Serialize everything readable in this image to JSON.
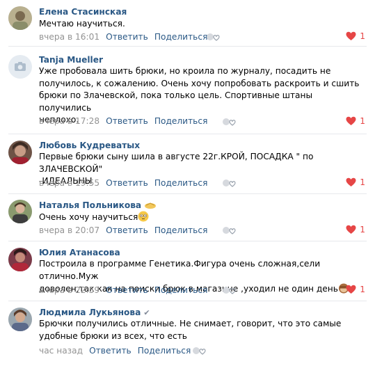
{
  "actions": {
    "reply": "Ответить",
    "share": "Поделиться"
  },
  "colors": {
    "link": "#2a5885",
    "meta": "#939393",
    "like": "#e64646"
  },
  "comments": [
    {
      "author": "Елена Стасинская",
      "text": "Мечтаю научиться.",
      "date": "вчера в 16:01",
      "likes": "1",
      "avatar_icon": "user-photo"
    },
    {
      "author": "Tanja Mueller",
      "text": "Уже пробовала шить брюки, но кроила по журналу, посадить не\nполучилось, к сожалению. Очень хочу попробовать раскроить и сшить\nбрюки по Злачевской, пока только цель. Спортивные штаны получились\nнеплохо.",
      "date": "вчера в 17:28",
      "likes": "1",
      "avatar_icon": "camera-icon"
    },
    {
      "author": "Любовь Кудреватых",
      "text": "Первые брюки сыну шила в августе 22г.КРОЙ, ПОСАДКА \" по ЗЛАЧЕВСКОЙ\"\n-ИДЕАЛЬНЫ",
      "date": "вчера в 19:55",
      "likes": "1",
      "avatar_icon": "user-photo"
    },
    {
      "author": "Наталья Польникова",
      "text": "Очень хочу научиться",
      "date": "вчера в 20:07",
      "likes": "1",
      "avatar_icon": "user-photo",
      "author_icon": "handshake-emoji",
      "text_icon": "flushed-face-emoji"
    },
    {
      "author": "Юлия Атанасова",
      "text": "Построила в программе Генетика.Фигура очень сложная,сели отлично.Муж\nдоволен,так как на поиски брюк в магазине ,уходил не один день",
      "date": "вчера в 22:59",
      "likes": "1",
      "avatar_icon": "user-photo",
      "text_icon": "see-no-evil-monkey-emoji"
    },
    {
      "author": "Людмила Лукьянова",
      "text": "Брючки получились отличные. Не снимает, говорит, что это самые\nудобные брюки из всех, что есть",
      "date": "час назад",
      "likes": "",
      "avatar_icon": "user-photo",
      "author_icon": "verified-check-icon"
    }
  ]
}
